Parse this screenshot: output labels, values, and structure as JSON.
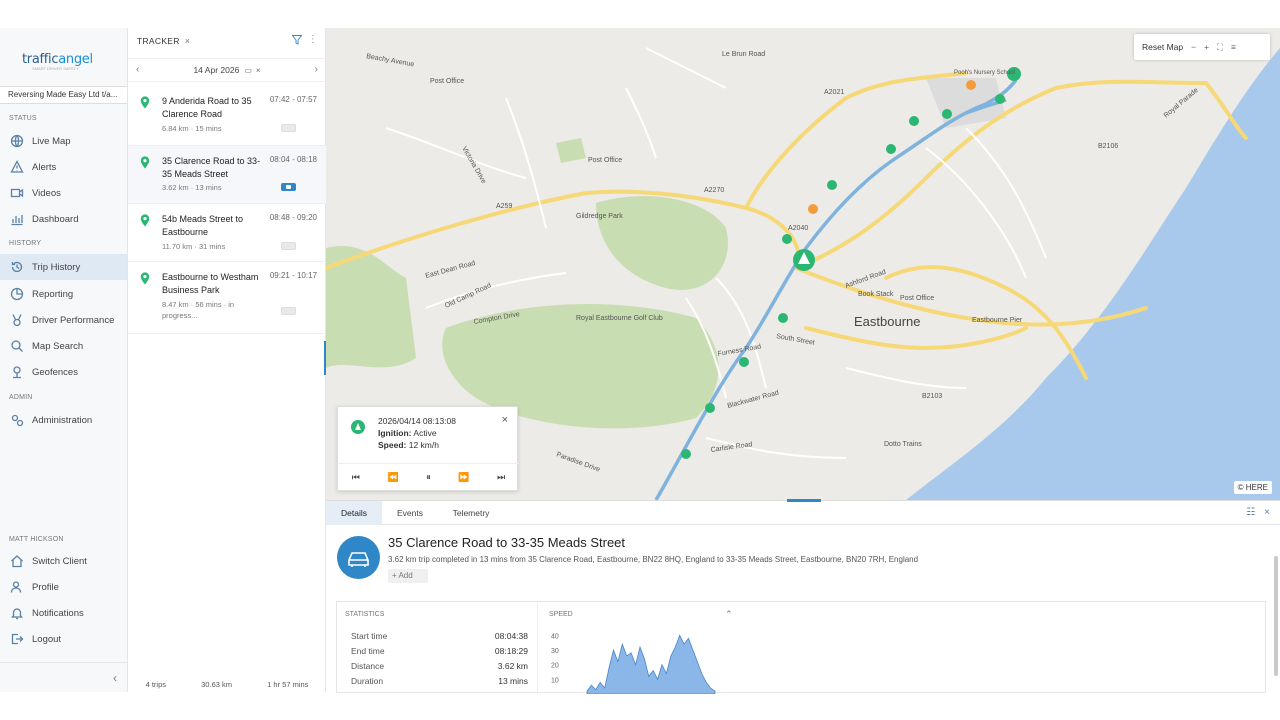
{
  "app": {
    "logo_text_a": "traffic",
    "logo_text_b": "angel",
    "company": "Reversing Made Easy Ltd t/a...",
    "sections": {
      "status": "Status",
      "history": "History",
      "admin": "Admin",
      "user": "Matt Hickson"
    }
  },
  "nav": {
    "live_map": "Live Map",
    "alerts": "Alerts",
    "videos": "Videos",
    "dashboard": "Dashboard",
    "trip_history": "Trip History",
    "reporting": "Reporting",
    "driver_performance": "Driver Performance",
    "map_search": "Map Search",
    "geofences": "Geofences",
    "administration": "Administration",
    "switch_client": "Switch Client",
    "profile": "Profile",
    "notifications": "Notifications",
    "logout": "Logout"
  },
  "tracker": {
    "title": "TRACKER",
    "date": "14 Apr 2026",
    "trips": [
      {
        "title": "9 Anderida Road to 35 Clarence Road",
        "time": "07:42 - 07:57",
        "meta": "6.84 km · 15 mins",
        "selected": false
      },
      {
        "title": "35 Clarence Road to 33-35 Meads Street",
        "time": "08:04 - 08:18",
        "meta": "3.62 km · 13 mins",
        "selected": true
      },
      {
        "title": "54b Meads Street to Eastbourne",
        "time": "08:48 - 09:20",
        "meta": "11.70 km · 31 mins",
        "selected": false
      },
      {
        "title": "Eastbourne to Westham Business Park",
        "time": "09:21 - 10:17",
        "meta": "8.47 km · 56 mins · in progress...",
        "selected": false
      }
    ],
    "footer": {
      "trips": "4 trips",
      "distance": "30.63 km",
      "duration": "1 hr 57 mins"
    }
  },
  "map": {
    "reset": "Reset Map",
    "attribution": "© HERE",
    "labels": {
      "eastbourne": "Eastbourne",
      "gildredge": "Gildredge Park",
      "golf": "Royal Eastbourne Golf Club",
      "east_dean": "East Dean Road",
      "ashford": "Ashford Road",
      "south_street": "South Street",
      "furness": "Furness Road",
      "carlisle": "Carlisle Road",
      "blackwater": "Blackwater Road",
      "post_office_1": "Post Office",
      "post_office_2": "Post Office",
      "post_office_3": "Post Office",
      "book_stack": "Book Stack",
      "pier": "Eastbourne Pier",
      "dotto": "Dotto Trains",
      "nursery": "Pooh's Nursery School",
      "a259": "A259",
      "a2270": "A2270",
      "a2021": "A2021",
      "b2106": "B2106",
      "b2103": "B2103",
      "a2040": "A2040",
      "royal_parade": "Royal Parade",
      "compton": "Compton Drive",
      "old_camp": "Old Camp Road",
      "paradise": "Paradise Drive",
      "victoria": "Victoria Drive",
      "le_brun": "Le Brun Road",
      "beachy": "Beachy Avenue"
    }
  },
  "popup": {
    "time": "2026/04/14 08:13:08",
    "ignition_label": "Ignition:",
    "ignition_value": "Active",
    "speed_label": "Speed:",
    "speed_value": "12 km/h"
  },
  "details": {
    "tabs": [
      "Details",
      "Events",
      "Telemetry"
    ],
    "title": "35 Clarence Road to 33-35 Meads Street",
    "description": "3.62 km trip completed in 13 mins from 35 Clarence Road, Eastbourne, BN22 8HQ, England to 33-35 Meads Street, Eastbourne, BN20 7RH, England",
    "add": "+ Add",
    "statistics_head": "Statistics",
    "speed_head": "Speed",
    "stats": [
      {
        "label": "Start time",
        "value": "08:04:38"
      },
      {
        "label": "End time",
        "value": "08:18:29"
      },
      {
        "label": "Distance",
        "value": "3.62 km"
      },
      {
        "label": "Duration",
        "value": "13 mins"
      }
    ]
  },
  "chart_data": {
    "type": "area",
    "title": "Speed",
    "y_ticks": [
      40,
      30,
      20,
      10
    ],
    "values": [
      2,
      6,
      3,
      8,
      4,
      18,
      30,
      22,
      34,
      26,
      28,
      20,
      32,
      24,
      12,
      16,
      10,
      20,
      14,
      26,
      32,
      40,
      34,
      38,
      30,
      22,
      14,
      8,
      4,
      2
    ]
  }
}
